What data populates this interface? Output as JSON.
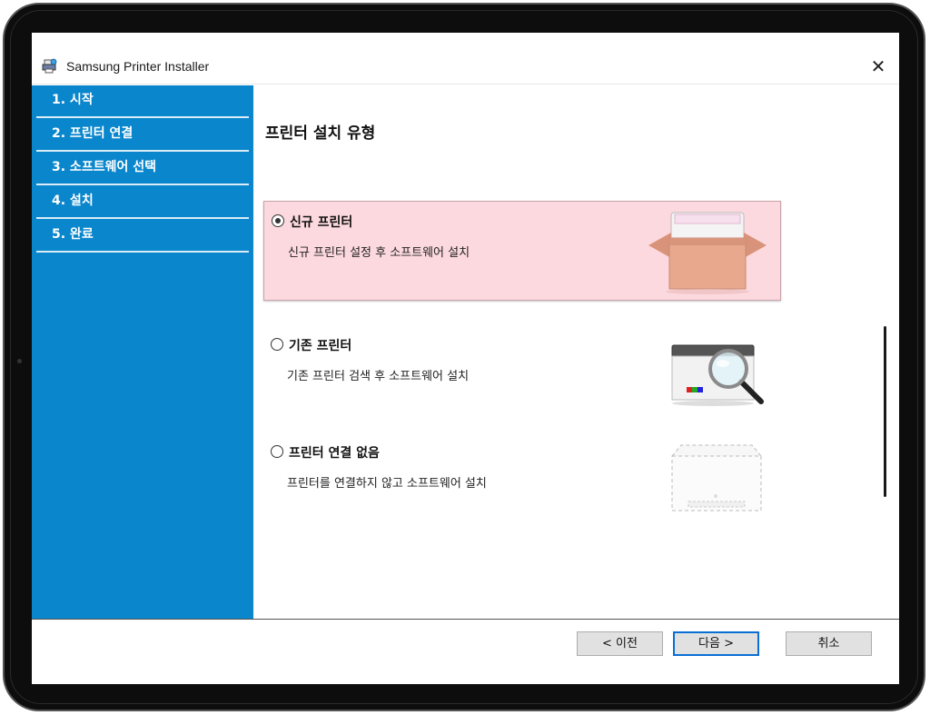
{
  "window": {
    "title": "Samsung Printer Installer"
  },
  "sidebar": {
    "steps": [
      {
        "label": "1. 시작"
      },
      {
        "label": "2. 프린터 연결"
      },
      {
        "label": "3. 소프트웨어 선택"
      },
      {
        "label": "4. 설치"
      },
      {
        "label": "5. 완료"
      }
    ]
  },
  "main": {
    "heading": "프린터 설치 유형",
    "options": [
      {
        "title": "신규 프린터",
        "description": "신규 프린터 설정 후 소프트웨어 설치",
        "selected": true
      },
      {
        "title": "기존 프린터",
        "description": "기존 프린터 검색 후 소프트웨어 설치",
        "selected": false
      },
      {
        "title": "프린터 연결 없음",
        "description": "프린터를 연결하지 않고 소프트웨어 설치",
        "selected": false
      }
    ]
  },
  "footer": {
    "back_label": "< 이전",
    "next_label": "다음 >",
    "cancel_label": "취소"
  },
  "colors": {
    "sidebar": "#0a86cc",
    "selected_option": "#fcd9de",
    "default_button_border": "#0a6fd4"
  },
  "icons": {
    "app": "printer-installer-icon",
    "close": "close-icon",
    "option_images": [
      "printer-in-box-icon",
      "printer-magnifier-icon",
      "printer-outline-icon"
    ]
  }
}
